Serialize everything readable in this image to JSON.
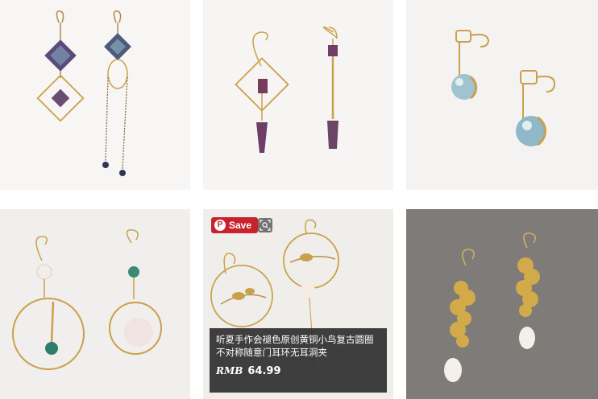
{
  "grid": {
    "items": [
      {
        "image_alt": "earring-product-image-1"
      },
      {
        "image_alt": "earring-product-image-2"
      },
      {
        "image_alt": "earring-product-image-3"
      },
      {
        "image_alt": "earring-product-image-4"
      },
      {
        "image_alt": "earring-product-image-5"
      },
      {
        "image_alt": "earring-product-image-6"
      }
    ]
  },
  "hover_card": {
    "save_label": "Save",
    "pin_icon": "pinterest-icon",
    "lens_icon": "visual-search-icon",
    "title": "听夏手作会褪色原创黄铜小鸟复古圆圈不对称随意门耳环无耳洞夹",
    "currency": "RMB",
    "price": "64.99"
  },
  "colors": {
    "save_button": "#c8232c",
    "caption_bg": "#262626",
    "gold": "#c9a14a"
  }
}
